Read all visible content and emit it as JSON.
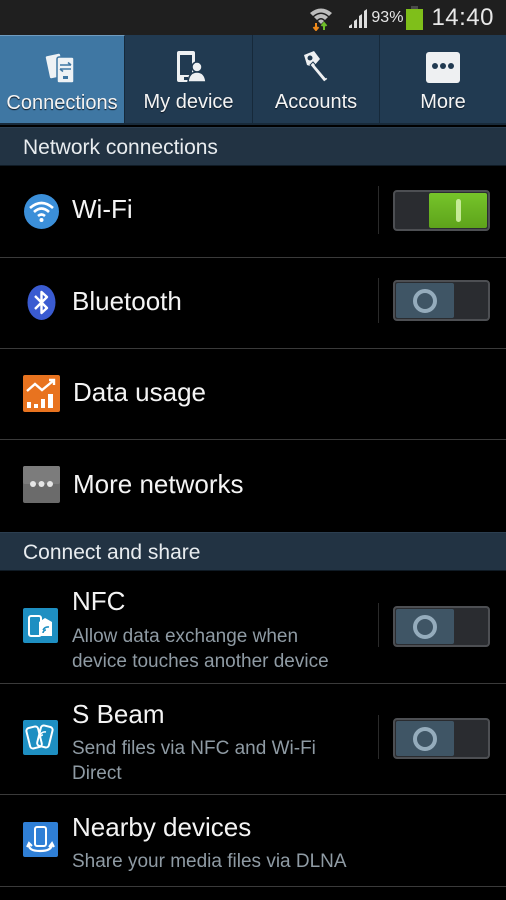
{
  "status_bar": {
    "battery_percent": "93%",
    "time": "14:40",
    "icons": [
      "wifi-data-activity-icon",
      "signal-strength-icon",
      "battery-icon"
    ],
    "battery_color": "#7fbf1a"
  },
  "tabs": [
    {
      "label": "Connections",
      "icon": "connections-icon",
      "active": true
    },
    {
      "label": "My device",
      "icon": "my-device-icon",
      "active": false
    },
    {
      "label": "Accounts",
      "icon": "accounts-key-icon",
      "active": false
    },
    {
      "label": "More",
      "icon": "more-dots-icon",
      "active": false
    }
  ],
  "sections": [
    {
      "header": "Network connections",
      "items": [
        {
          "title": "Wi-Fi",
          "icon": "wifi-icon",
          "toggle": "on"
        },
        {
          "title": "Bluetooth",
          "icon": "bluetooth-icon",
          "toggle": "off"
        },
        {
          "title": "Data usage",
          "icon": "data-usage-icon"
        },
        {
          "title": "More networks",
          "icon": "more-networks-icon"
        }
      ]
    },
    {
      "header": "Connect and share",
      "items": [
        {
          "title": "NFC",
          "subtitle_lines": [
            "Allow data exchange when",
            "device touches another device"
          ],
          "icon": "nfc-icon",
          "toggle": "off"
        },
        {
          "title": "S Beam",
          "subtitle_lines": [
            "Send files via NFC and Wi-Fi",
            "Direct"
          ],
          "icon": "s-beam-icon",
          "toggle": "off"
        },
        {
          "title": "Nearby devices",
          "subtitle_lines": [
            "Share your media files via DLNA"
          ],
          "icon": "nearby-devices-icon"
        }
      ]
    }
  ],
  "colors": {
    "active_tab": "#3f77a3",
    "tab_bar": "#213a51",
    "section_header": "#223343",
    "toggle_on": "#6bb624",
    "toggle_off_knob": "#3f5565"
  }
}
